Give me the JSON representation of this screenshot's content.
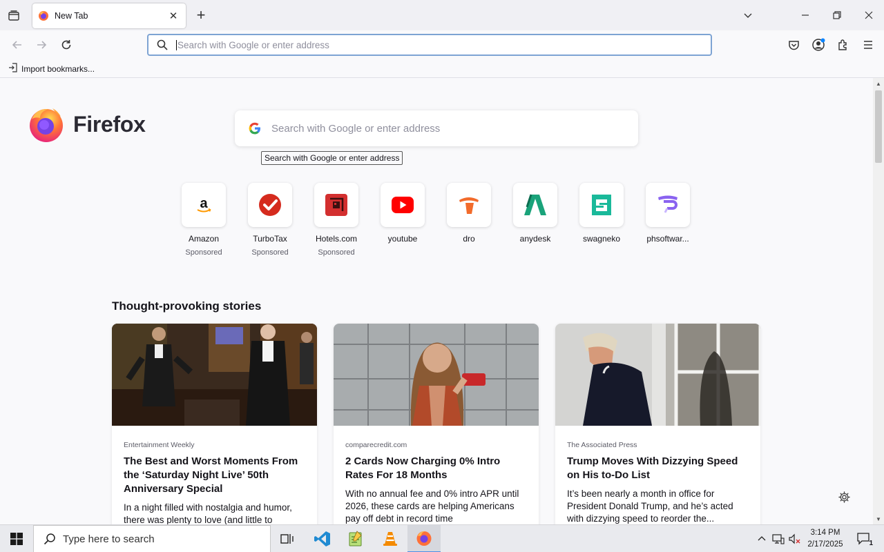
{
  "browser": {
    "tab": {
      "title": "New Tab"
    },
    "urlbar": {
      "placeholder": "Search with Google or enter address"
    },
    "bookmarks": {
      "import_label": "Import bookmarks..."
    }
  },
  "newtab": {
    "brand": "Firefox",
    "search": {
      "placeholder": "Search with Google or enter address",
      "tooltip": "Search with Google or enter address"
    },
    "top_sites": [
      {
        "label": "Amazon",
        "sub": "Sponsored",
        "icon": "amazon-icon"
      },
      {
        "label": "TurboTax",
        "sub": "Sponsored",
        "icon": "turbotax-icon"
      },
      {
        "label": "Hotels.com",
        "sub": "Sponsored",
        "icon": "hotels-icon"
      },
      {
        "label": "youtube",
        "sub": "",
        "icon": "youtube-icon"
      },
      {
        "label": "dro",
        "sub": "",
        "icon": "dro-icon"
      },
      {
        "label": "anydesk",
        "sub": "",
        "icon": "anydesk-icon"
      },
      {
        "label": "swagneko",
        "sub": "",
        "icon": "swagneko-icon"
      },
      {
        "label": "phsoftwar...",
        "sub": "",
        "icon": "phsoftware-icon"
      }
    ],
    "stories_heading": "Thought-provoking stories",
    "stories": [
      {
        "source": "Entertainment Weekly",
        "title": "The Best and Worst Moments From the ‘Saturday Night Live’ 50th Anniversary Special",
        "excerpt": "In a night filled with nostalgia and humor, there was plenty to love (and little to"
      },
      {
        "source": "comparecredit.com",
        "title": "2 Cards Now Charging 0% Intro Rates For 18 Months",
        "excerpt": "With no annual fee and 0% intro APR until 2026, these cards are helping Americans pay off debt in record time"
      },
      {
        "source": "The Associated Press",
        "title": "Trump Moves With Dizzying Speed on His to-Do List",
        "excerpt": "It’s been nearly a month in office for President Donald Trump, and he’s acted with dizzying speed to reorder the..."
      }
    ]
  },
  "taskbar": {
    "search_placeholder": "Type here to search",
    "time": "3:14 PM",
    "date": "2/17/2025",
    "notification_count": "1"
  },
  "colors": {
    "accent": "#7da3d3",
    "youtube": "#ff0000",
    "turbotax": "#d52b1e",
    "hotels": "#d32f2f",
    "anydesk": "#1aa37a",
    "swagneko": "#1ab99a",
    "phsoftware": "#8a63f0",
    "dro": "#f26b2b"
  }
}
